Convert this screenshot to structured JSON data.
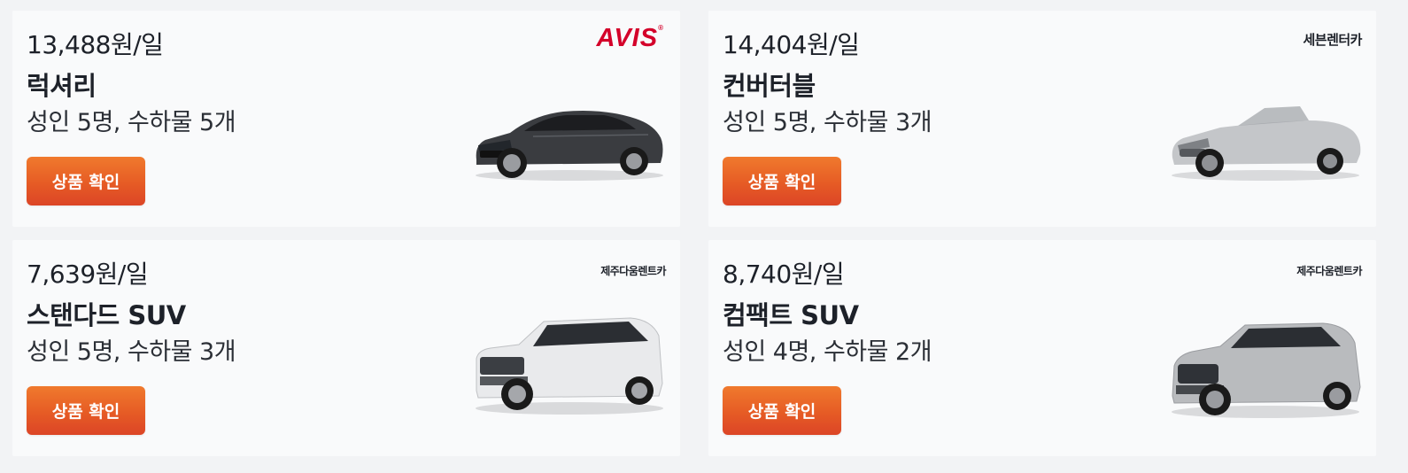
{
  "cards": [
    {
      "price": "13,488원/일",
      "name": "럭셔리",
      "capacity": "성인 5명, 수하물 5개",
      "button_label": "상품 확인",
      "vendor": "AVIS",
      "car_color": "#3a3c40"
    },
    {
      "price": "14,404원/일",
      "name": "컨버터블",
      "capacity": "성인 5명, 수하물 3개",
      "button_label": "상품 확인",
      "vendor": "세븐렌터카",
      "car_color": "#c4c6c9"
    },
    {
      "price": "7,639원/일",
      "name": "스탠다드 SUV",
      "capacity": "성인 5명, 수하물 3개",
      "button_label": "상품 확인",
      "vendor": "제주다움렌트카",
      "car_color": "#e9eaec"
    },
    {
      "price": "8,740원/일",
      "name": "컴팩트 SUV",
      "capacity": "성인 4명, 수하물 2개",
      "button_label": "상품 확인",
      "vendor": "제주다움렌트카",
      "car_color": "#b9bbbe"
    }
  ]
}
